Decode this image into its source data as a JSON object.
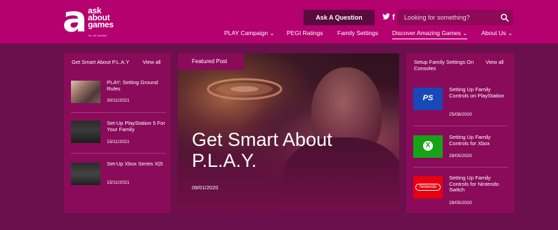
{
  "header": {
    "logo": {
      "line1": "ask",
      "line2": "about",
      "line3": "games",
      "tagline": "for UK families"
    },
    "ask_button": "Ask A Question",
    "twitter_glyph": "🐦",
    "facebook_glyph": "f",
    "search_placeholder": "Looking for something?",
    "nav": {
      "play_campaign": "PLAY Campaign ⌄",
      "pegi_ratings": "PEGI Ratings",
      "family_settings": "Family Settings",
      "discover_games": "Discover Amazing Games ⌄",
      "about_us": "About Us ⌄"
    },
    "colors": {
      "header": "#b5006f",
      "body": "#6b0f4d",
      "panel": "#8a0b5a"
    }
  },
  "left": {
    "heading": "Get Smart About P.L.A.Y",
    "view_all": "View all",
    "items": [
      {
        "title": "PLAY: Setting Ground Rules",
        "date": "30/11/2021"
      },
      {
        "title": "Set-Up PlayStation 5 For Your Family",
        "date": "15/11/2021"
      },
      {
        "title": "Set-Up Xbox Series X|S",
        "date": "15/11/2021"
      }
    ]
  },
  "featured": {
    "tag": "Featured Post",
    "title": "Get Smart About P.L.A.Y.",
    "date": "09/01/2020"
  },
  "right": {
    "heading": "Setup Family Settings On Consoles",
    "view_all": "View all",
    "items": [
      {
        "title": "Setting Up Family Controls on PlayStation",
        "date": "25/08/2020",
        "icon": "playstation-logo-icon",
        "logo_text": "PS"
      },
      {
        "title": "Setting Up Family Controls for Xbox",
        "date": "28/05/2020",
        "icon": "xbox-logo-icon",
        "logo_text": "X"
      },
      {
        "title": "Setting Up Family Controls for Nintendo Switch",
        "date": "28/05/2020",
        "icon": "nintendo-logo-icon",
        "logo_text": "Nintendo"
      }
    ]
  }
}
